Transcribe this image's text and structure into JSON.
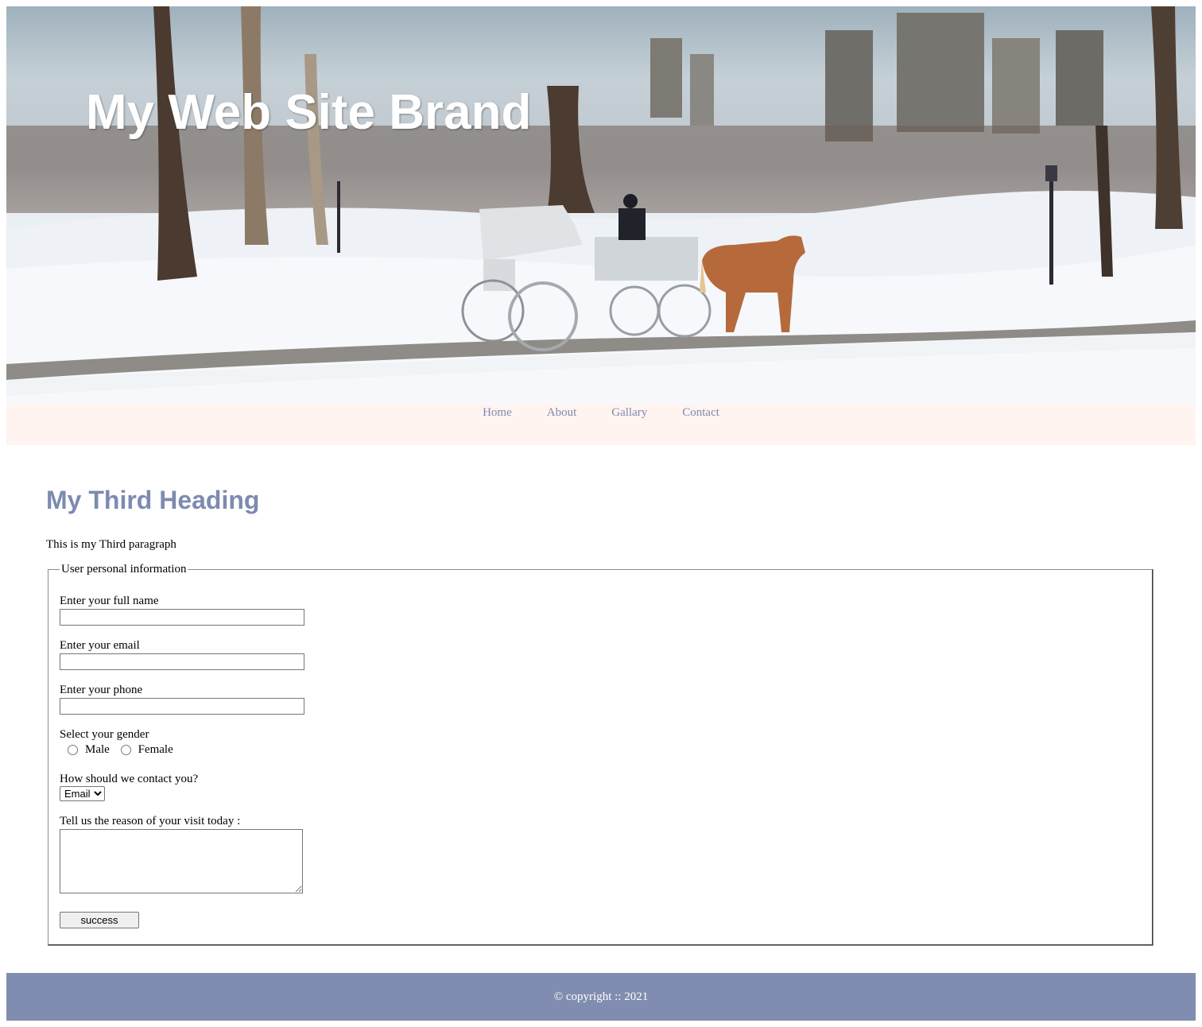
{
  "banner": {
    "brand": "My Web Site Brand",
    "image": "winter-park-horse-carriage-photo"
  },
  "nav": {
    "items": [
      {
        "label": "Home"
      },
      {
        "label": "About"
      },
      {
        "label": "Gallary"
      },
      {
        "label": "Contact"
      }
    ]
  },
  "main": {
    "heading": "My Third Heading",
    "paragraph": "This is my Third paragraph"
  },
  "form": {
    "legend": "User personal information",
    "name_label": "Enter your full name",
    "name_value": "",
    "email_label": "Enter your email",
    "email_value": "",
    "phone_label": "Enter your phone",
    "phone_value": "",
    "gender_label": "Select your gender",
    "gender_options": [
      "Male",
      "Female"
    ],
    "contact_label": "How should we contact you?",
    "contact_selected": "Email",
    "reason_label": "Tell us the reason of your visit today :",
    "reason_value": "",
    "submit_label": "success"
  },
  "footer": {
    "text": "© copyright :: 2021"
  },
  "colors": {
    "accent": "#7d8ab1",
    "nav_bg": "#fff4f0",
    "footer_bg": "#818db0"
  }
}
